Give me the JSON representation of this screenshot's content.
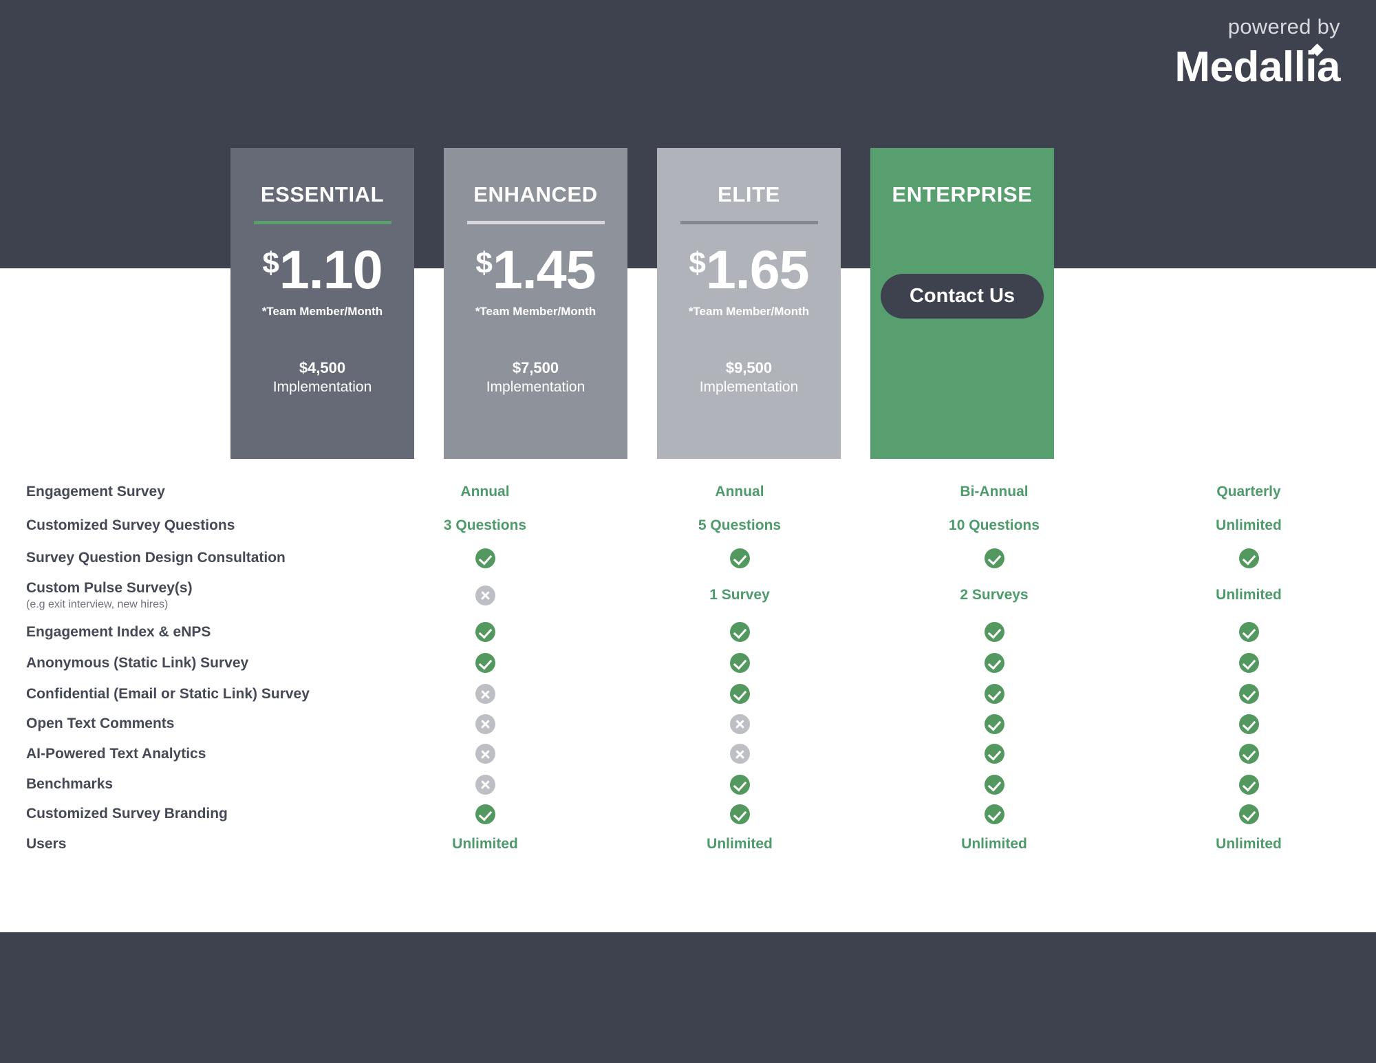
{
  "brand": {
    "powered_by": "powered by",
    "name": "Medallia"
  },
  "colors": {
    "header_band": "#3e424e",
    "footer_band": "#3e424e",
    "accent_green": "#53995f",
    "value_text_green": "#4d9a6a",
    "enterprise_card": "#589f70",
    "feature_label": "#454956",
    "mark_no": "#bdbfc4"
  },
  "plans": [
    {
      "title": "ESSENTIAL",
      "currency": "$",
      "price": "1.10",
      "price_note": "*Team Member/Month",
      "implementation_amount": "$4,500",
      "implementation_label": "Implementation",
      "card_color": "#666a77",
      "rule_color": "#5a9e70",
      "cta": null
    },
    {
      "title": "ENHANCED",
      "currency": "$",
      "price": "1.45",
      "price_note": "*Team Member/Month",
      "implementation_amount": "$7,500",
      "implementation_label": "Implementation",
      "card_color": "#8e929a",
      "rule_color": "#d6d8db",
      "cta": null
    },
    {
      "title": "ELITE",
      "currency": "$",
      "price": "1.65",
      "price_note": "*Team Member/Month",
      "implementation_amount": "$9,500",
      "implementation_label": "Implementation",
      "card_color": "#b0b4ba",
      "rule_color": "#85898f",
      "cta": null
    },
    {
      "title": "ENTERPRISE",
      "currency": null,
      "price": null,
      "price_note": null,
      "implementation_amount": null,
      "implementation_label": null,
      "card_color": "#589f70",
      "rule_color": null,
      "cta": "Contact Us"
    }
  ],
  "features": [
    {
      "label": "Engagement Survey",
      "sub": null,
      "values": [
        {
          "type": "text",
          "text": "Annual"
        },
        {
          "type": "text",
          "text": "Annual"
        },
        {
          "type": "text",
          "text": "Bi-Annual"
        },
        {
          "type": "text",
          "text": "Quarterly"
        }
      ]
    },
    {
      "label": "Customized Survey Questions",
      "sub": null,
      "values": [
        {
          "type": "text",
          "text": "3 Questions"
        },
        {
          "type": "text",
          "text": "5 Questions"
        },
        {
          "type": "text",
          "text": "10  Questions"
        },
        {
          "type": "text",
          "text": "Unlimited"
        }
      ]
    },
    {
      "label": "Survey Question Design Consultation",
      "sub": null,
      "values": [
        {
          "type": "yes"
        },
        {
          "type": "yes"
        },
        {
          "type": "yes"
        },
        {
          "type": "yes"
        }
      ]
    },
    {
      "label": "Custom Pulse Survey(s)",
      "sub": "(e.g exit interview, new hires)",
      "values": [
        {
          "type": "no"
        },
        {
          "type": "text",
          "text": "1 Survey"
        },
        {
          "type": "text",
          "text": "2 Surveys"
        },
        {
          "type": "text",
          "text": "Unlimited"
        }
      ]
    },
    {
      "label": "Engagement Index & eNPS",
      "sub": null,
      "values": [
        {
          "type": "yes"
        },
        {
          "type": "yes"
        },
        {
          "type": "yes"
        },
        {
          "type": "yes"
        }
      ]
    },
    {
      "label": "Anonymous (Static Link) Survey",
      "sub": null,
      "values": [
        {
          "type": "yes"
        },
        {
          "type": "yes"
        },
        {
          "type": "yes"
        },
        {
          "type": "yes"
        }
      ]
    },
    {
      "label": "Confidential (Email or Static Link) Survey",
      "sub": null,
      "values": [
        {
          "type": "no"
        },
        {
          "type": "yes"
        },
        {
          "type": "yes"
        },
        {
          "type": "yes"
        }
      ]
    },
    {
      "label": "Open Text Comments",
      "sub": null,
      "values": [
        {
          "type": "no"
        },
        {
          "type": "no"
        },
        {
          "type": "yes"
        },
        {
          "type": "yes"
        }
      ]
    },
    {
      "label": "AI-Powered Text Analytics",
      "sub": null,
      "values": [
        {
          "type": "no"
        },
        {
          "type": "no"
        },
        {
          "type": "yes"
        },
        {
          "type": "yes"
        }
      ]
    },
    {
      "label": "Benchmarks",
      "sub": null,
      "values": [
        {
          "type": "no"
        },
        {
          "type": "yes"
        },
        {
          "type": "yes"
        },
        {
          "type": "yes"
        }
      ]
    },
    {
      "label": "Customized Survey Branding",
      "sub": null,
      "values": [
        {
          "type": "yes"
        },
        {
          "type": "yes"
        },
        {
          "type": "yes"
        },
        {
          "type": "yes"
        }
      ]
    },
    {
      "label": "Users",
      "sub": null,
      "values": [
        {
          "type": "text",
          "text": "Unlimited"
        },
        {
          "type": "text",
          "text": "Unlimited"
        },
        {
          "type": "text",
          "text": "Unlimited"
        },
        {
          "type": "text",
          "text": "Unlimited"
        }
      ]
    }
  ]
}
